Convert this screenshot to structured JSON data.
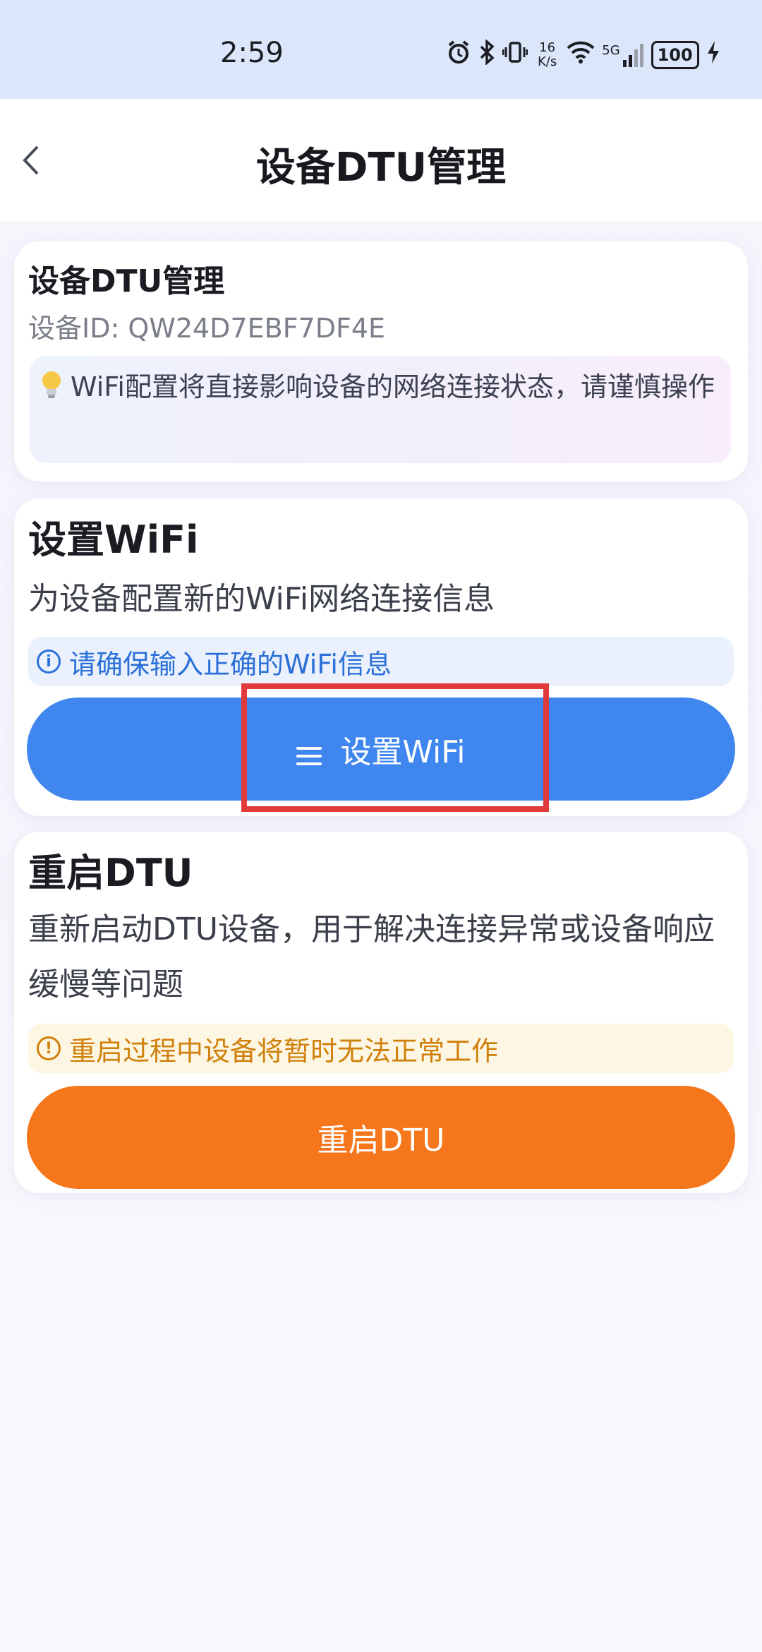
{
  "status_bar": {
    "time": "2:59",
    "net_speed_top": "16",
    "net_speed_bottom": "K/s",
    "signal_label": "5G",
    "battery": "100"
  },
  "header": {
    "title": "设备DTU管理"
  },
  "device_card": {
    "title": "设备DTU管理",
    "device_id": "设备ID: QW24D7EBF7DF4E",
    "tip": "WiFi配置将直接影响设备的网络连接状态，请谨慎操作"
  },
  "wifi_section": {
    "title": "设置WiFi",
    "description": "为设备配置新的WiFi网络连接信息",
    "info": "请确保输入正确的WiFi信息",
    "button_label": "设置WiFi"
  },
  "restart_section": {
    "title": "重启DTU",
    "description": "重新启动DTU设备，用于解决连接异常或设备响应缓慢等问题",
    "warning": "重启过程中设备将暂时无法正常工作",
    "button_label": "重启DTU"
  },
  "colors": {
    "primary_blue": "#3f87ee",
    "accent_orange": "#f6761c",
    "highlight_red": "#e03a3a"
  }
}
